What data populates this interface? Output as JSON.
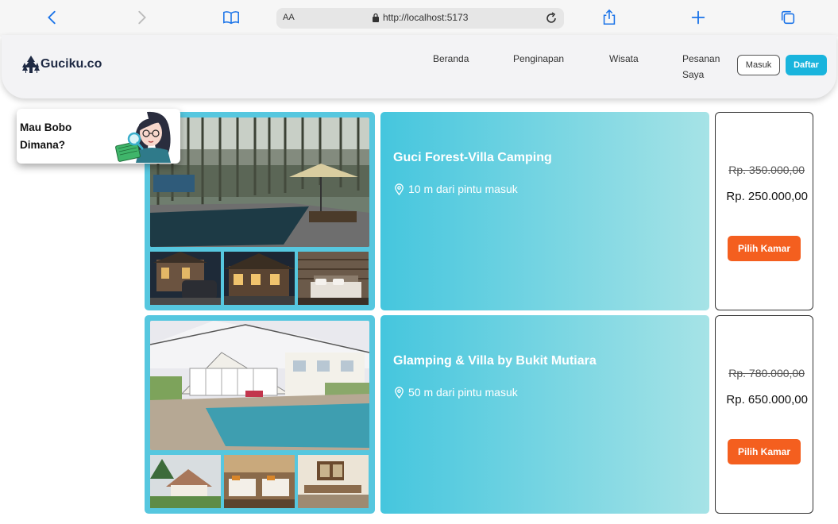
{
  "browser": {
    "url": "http://localhost:5173",
    "text_size_label": "AA"
  },
  "site": {
    "logo_text": "Guciku.co",
    "nav": [
      "Beranda",
      "Penginapan",
      "Wisata",
      "Pesanan Saya"
    ],
    "login_label": "Masuk",
    "register_label": "Daftar"
  },
  "promo": {
    "text": "Mau Bobo Dimana?"
  },
  "listings": [
    {
      "name": "Guci Forest-Villa Camping",
      "distance": "10 m dari pintu masuk",
      "price_old": "Rp. 350.000,00",
      "price_new": "Rp. 250.000,00",
      "button_label": "Pilih Kamar"
    },
    {
      "name": "Glamping & Villa by Bukit Mutiara",
      "distance": "50 m dari pintu masuk",
      "price_old": "Rp. 780.000,00",
      "price_new": "Rp. 650.000,00",
      "button_label": "Pilih Kamar"
    }
  ],
  "colors": {
    "accent": "#19b4dd",
    "cta": "#f45f1f",
    "gallery_frame": "#56c7df"
  }
}
